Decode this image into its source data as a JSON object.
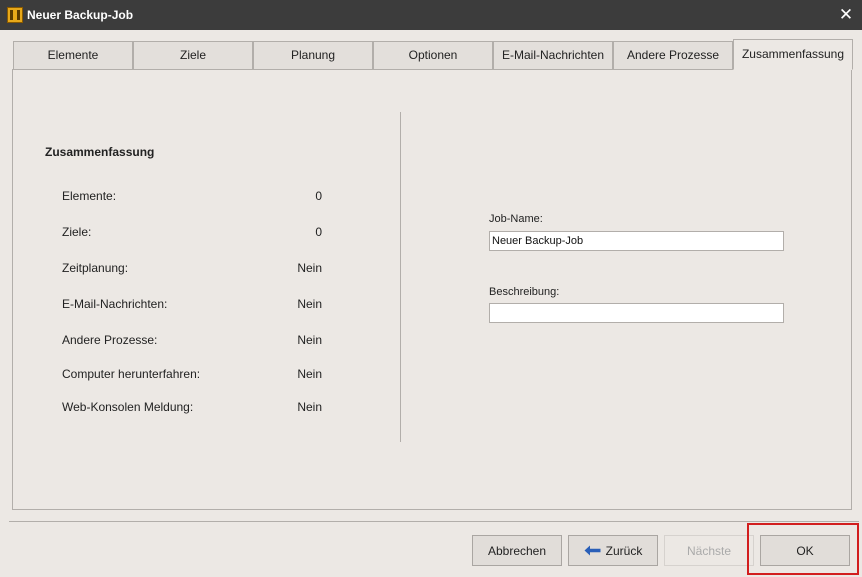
{
  "window": {
    "title": "Neuer Backup-Job",
    "close_glyph": "✕"
  },
  "tabs": [
    {
      "label": "Elemente"
    },
    {
      "label": "Ziele"
    },
    {
      "label": "Planung"
    },
    {
      "label": "Optionen"
    },
    {
      "label": "E-Mail-Nachrichten"
    },
    {
      "label": "Andere Prozesse"
    },
    {
      "label": "Zusammenfassung",
      "active": true
    }
  ],
  "summary": {
    "heading": "Zusammenfassung",
    "rows": [
      {
        "label": "Elemente:",
        "value": "0"
      },
      {
        "label": "Ziele:",
        "value": "0"
      },
      {
        "label": "Zeitplanung:",
        "value": "Nein"
      },
      {
        "label": "E-Mail-Nachrichten:",
        "value": "Nein"
      },
      {
        "label": "Andere Prozesse:",
        "value": "Nein"
      },
      {
        "label": "Computer herunterfahren:",
        "value": "Nein"
      },
      {
        "label": "Web-Konsolen Meldung:",
        "value": "Nein"
      }
    ]
  },
  "form": {
    "job_name_label": "Job-Name:",
    "job_name_value": "Neuer Backup-Job",
    "description_label": "Beschreibung:",
    "description_value": ""
  },
  "buttons": {
    "cancel": "Abbrechen",
    "back": "Zurück",
    "next": "Nächste",
    "ok": "OK"
  },
  "icons": {
    "app": "backup-app-icon",
    "back": "arrow-left-icon"
  },
  "colors": {
    "titlebar": "#3c3c3c",
    "highlight": "#d21e1e",
    "back_arrow": "#2a5fb8"
  }
}
